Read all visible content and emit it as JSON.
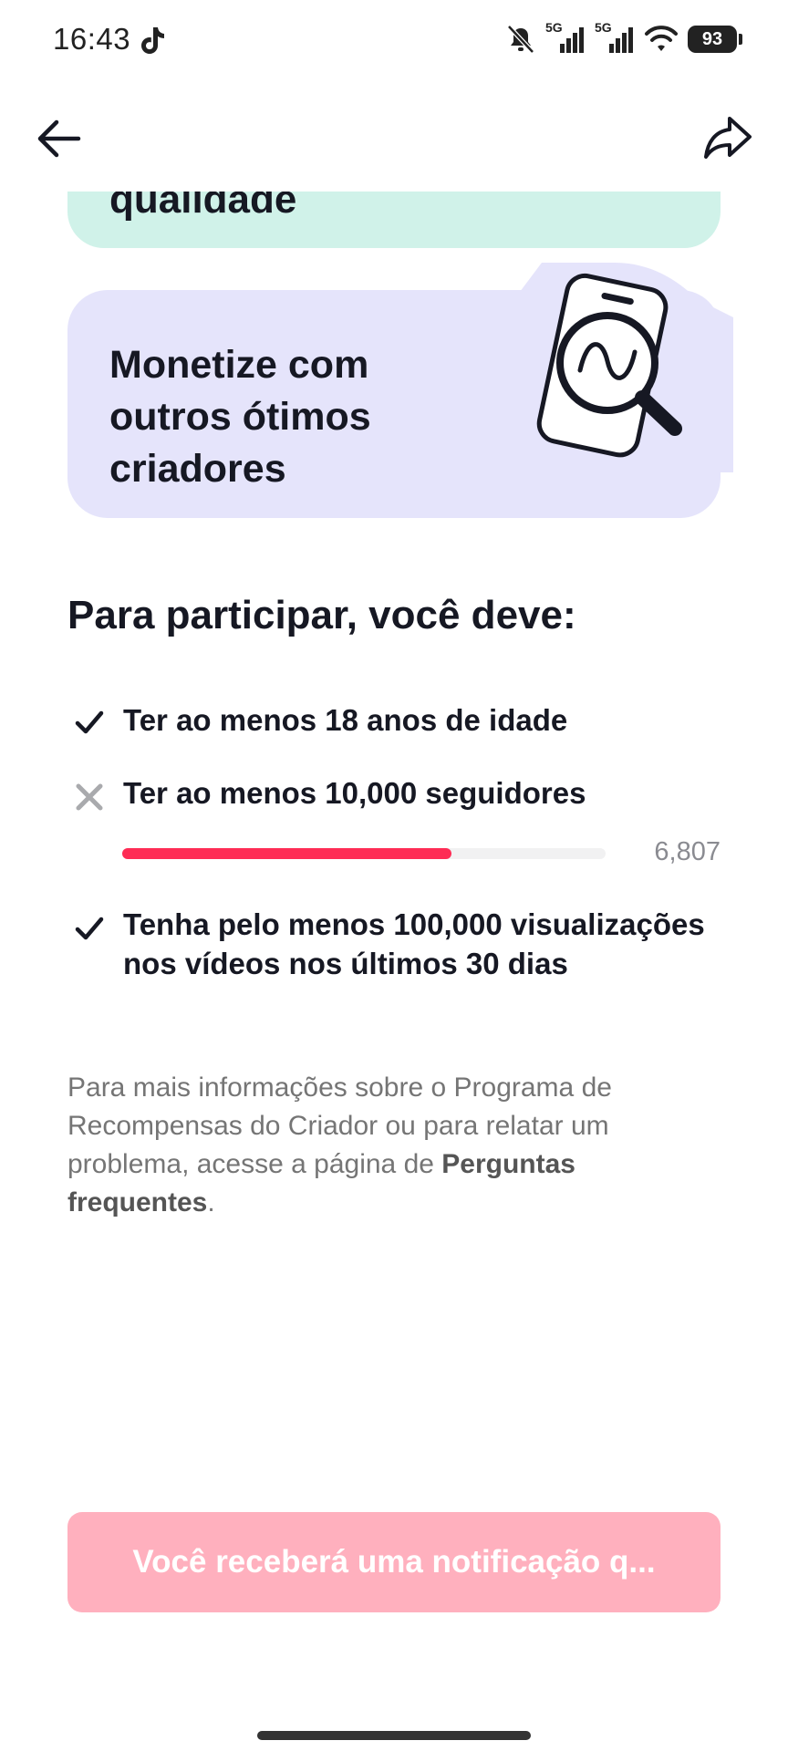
{
  "status_bar": {
    "time": "16:43",
    "network_1": "5G",
    "network_2": "5G",
    "battery": "93",
    "icons": [
      "tiktok-icon",
      "mute-icon",
      "signal-icon",
      "signal-icon",
      "wifi-icon",
      "battery-icon"
    ]
  },
  "nav": {
    "back_icon": "arrow-left-icon",
    "share_icon": "share-icon"
  },
  "cards": {
    "green_title": "qualidade",
    "purple_title": "Monetize com outros ótimos criadores"
  },
  "requirements": {
    "heading": "Para participar, você deve:",
    "items": [
      {
        "text": "Ter ao menos 18 anos de idade",
        "status": "met"
      },
      {
        "text": "Ter ao menos 10,000 seguidores",
        "status": "not-met"
      },
      {
        "text": "Tenha pelo menos 100,000 visualizações nos vídeos nos últimos 30 dias",
        "status": "met"
      }
    ],
    "followers_progress": {
      "current_label": "6,807",
      "current": 6807,
      "target": 10000,
      "fraction": 0.6807,
      "fill_color": "#fe2c55"
    }
  },
  "info": {
    "text_before": "Para mais informações sobre o Programa de Recompensas do Criador ou para relatar um problema, acesse a página de ",
    "link": "Perguntas frequentes",
    "text_after": "."
  },
  "button": {
    "label": "Você receberá uma notificação q..."
  },
  "colors": {
    "accent": "#fe2c55",
    "button_disabled": "#ffb0be",
    "card_green": "#d0f2e9",
    "card_purple": "#e5e4fb"
  }
}
